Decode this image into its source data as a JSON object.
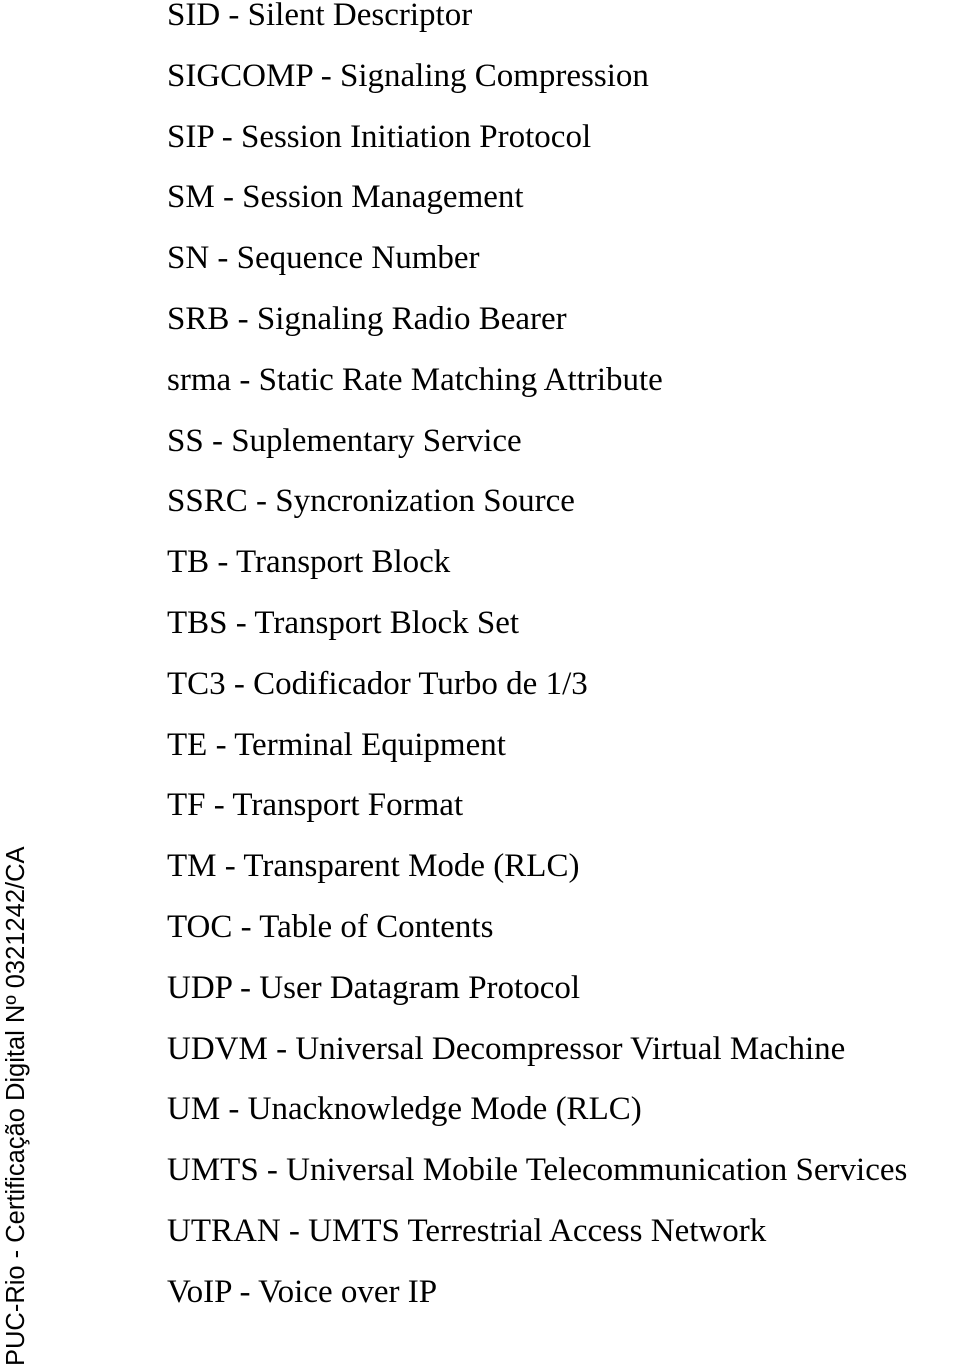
{
  "entries": [
    "SID - Silent Descriptor",
    "SIGCOMP - Signaling Compression",
    "SIP - Session Initiation Protocol",
    "SM - Session Management",
    "SN - Sequence Number",
    "SRB - Signaling Radio Bearer",
    "srma - Static Rate Matching Attribute",
    "SS - Suplementary Service",
    "SSRC - Syncronization Source",
    "TB - Transport Block",
    "TBS - Transport Block Set",
    "TC3 - Codificador Turbo de 1/3",
    "TE - Terminal Equipment",
    "TF - Transport Format",
    "TM - Transparent Mode (RLC)",
    "TOC - Table of Contents",
    "UDP - User Datagram Protocol",
    "UDVM - Universal Decompressor Virtual Machine",
    "UM - Unacknowledge Mode (RLC)",
    "UMTS - Universal Mobile Telecommunication Services",
    "UTRAN - UMTS Terrestrial Access Network",
    "VoIP - Voice over IP"
  ],
  "watermark": "PUC-Rio - Certificação Digital Nº 0321242/CA"
}
